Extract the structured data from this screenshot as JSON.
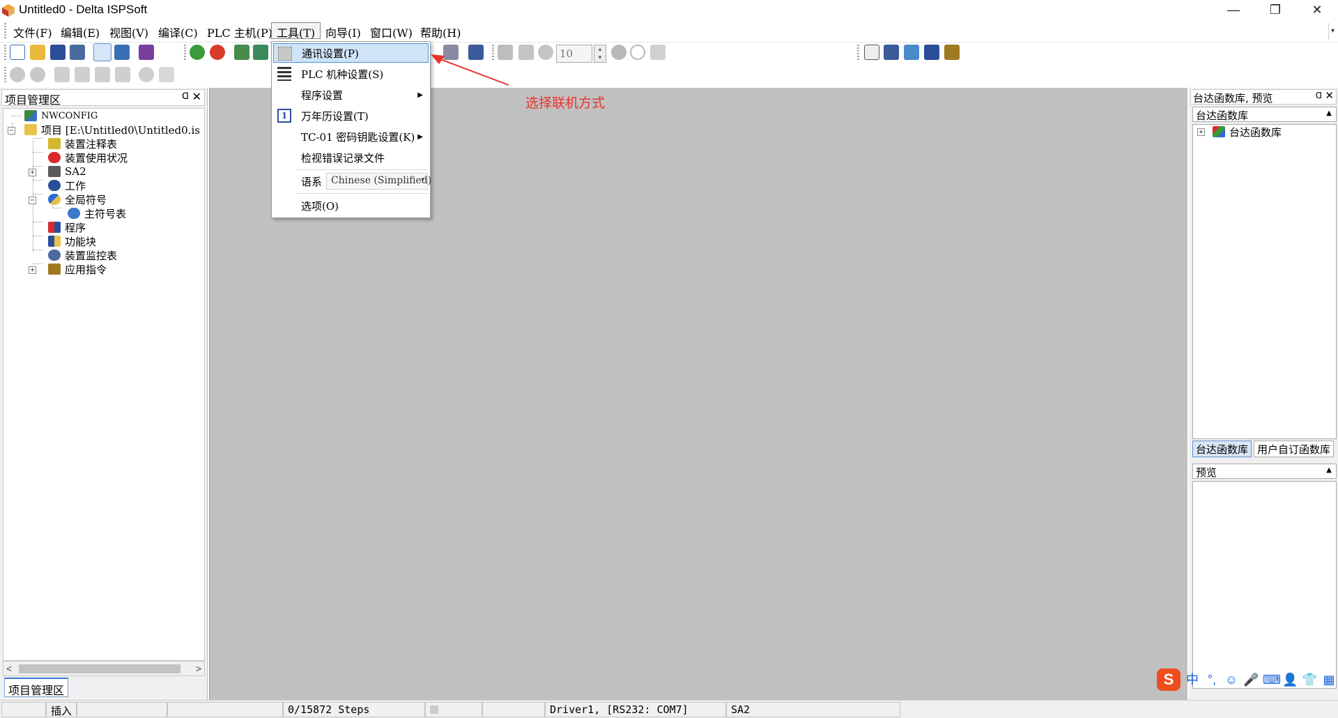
{
  "window": {
    "title": "Untitled0 - Delta ISPSoft",
    "minimize": "—",
    "restore": "❐",
    "close": "✕"
  },
  "menubar": {
    "items": [
      "文件(F)",
      "编辑(E)",
      "视图(V)",
      "编译(C)",
      "PLC 主机(P)",
      "工具(T)",
      "向导(I)",
      "窗口(W)",
      "帮助(H)"
    ],
    "active_index": 5,
    "overflow": "▾"
  },
  "toolbar": {
    "scan_value": "10",
    "spin_up": "▲",
    "spin_down": "▼"
  },
  "left_panel": {
    "title": "项目管理区",
    "pin": "ᗡ",
    "close": "✕",
    "tab_label": "项目管理区",
    "tree": {
      "nwconfig": "NWCONFIG",
      "project": "项目 [E:\\Untitled0\\Untitled0.is",
      "device_comment": "装置注释表",
      "device_usage": "装置使用状况",
      "sa2": "SA2",
      "work": "工作",
      "global_symbols": "全局符号",
      "main_symbol_table": "主符号表",
      "program": "程序",
      "function_block": "功能块",
      "device_monitor": "装置监控表",
      "app_instructions": "应用指令",
      "expand_minus": "−",
      "expand_plus": "+"
    },
    "scroll_left": "<",
    "scroll_right": ">"
  },
  "tools_menu": {
    "items": {
      "comm_settings": "通讯设置(P)",
      "plc_model": "PLC 机种设置(S)",
      "program_settings": "程序设置",
      "calendar": "万年历设置(T)",
      "tc01": "TC-01 密码钥匙设置(K)",
      "error_log": "检视错误记录文件",
      "language_label": "语系",
      "language_value": "Chinese (Simplified)",
      "options": "选项(O)"
    },
    "submenu_arrow": "▶",
    "calendar_icon_text": "1",
    "select_caret": "▾"
  },
  "annotation": {
    "text": "选择联机方式",
    "color": "#e8332f"
  },
  "right_panel": {
    "title": "台达函数库, 预览",
    "pin": "ᗡ",
    "close": "✕",
    "library_dropdown": "台达函数库",
    "library_tree_root": "台达函数库",
    "tabs": [
      "台达函数库",
      "用户自订函数库"
    ],
    "preview_dropdown": "预览",
    "caret": "▲",
    "expand": "+"
  },
  "status_bar": {
    "mode": "插入",
    "steps": "0/15872 Steps",
    "driver": "Driver1, [RS232: COM7]",
    "device": "SA2"
  },
  "ime": {
    "logo": "S",
    "lang": "中",
    "punct": "°,",
    "emoji": "☺",
    "mic": "🎤",
    "keyboard": "⌨",
    "user": "👤",
    "shirt": "👕",
    "grid": "▦"
  },
  "colors": {
    "workspace": "#c0c0c0",
    "highlight": "#cfe4f7",
    "annotation": "#e8332f",
    "ime_brand": "#ee4d1c"
  }
}
